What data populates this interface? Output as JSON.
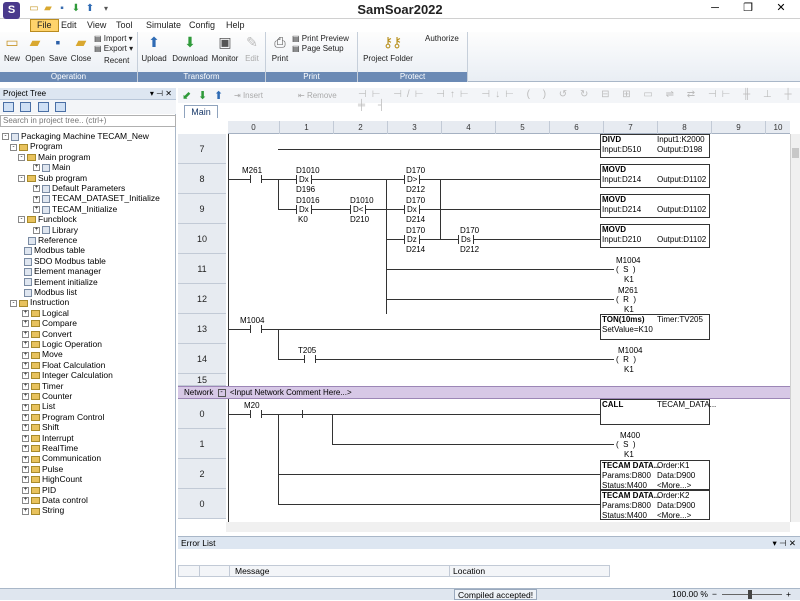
{
  "app": {
    "title": "SamSoar2022",
    "logo": "S"
  },
  "menus": [
    "File",
    "Edit",
    "View",
    "Tool",
    "Simulate",
    "Config",
    "Help"
  ],
  "ribbon": {
    "operation": {
      "label": "Operation",
      "new": "New",
      "open": "Open",
      "save": "Save",
      "close": "Close",
      "import": "Import",
      "export": "Export",
      "recent": "Recent"
    },
    "transform": {
      "label": "Transform",
      "upload": "Upload",
      "download": "Download",
      "monitor": "Monitor",
      "edit": "Edit"
    },
    "print": {
      "label": "Print",
      "print": "Print",
      "preview": "Print Preview",
      "setup": "Page Setup"
    },
    "protect": {
      "label": "Protect",
      "project_folder": "Project Folder",
      "authorize": "Authorize"
    }
  },
  "project_tree": {
    "title": "Project Tree",
    "search_placeholder": "Search in project tree.. (ctrl+)",
    "nodes": [
      "Packaging Machine TECAM_New",
      "Program",
      "Main program",
      "Main",
      "Sub program",
      "Default Parameters",
      "TECAM_DATASET_Initialize",
      "TECAM_Initialize",
      "Funcblock",
      "Library",
      "Reference",
      "Modbus table",
      "SDO Modbus table",
      "Element manager",
      "Element initialize",
      "Modbus list",
      "Instruction",
      "Logical",
      "Compare",
      "Convert",
      "Logic Operation",
      "Move",
      "Float Calculation",
      "Integer Calculation",
      "Timer",
      "Counter",
      "List",
      "Program Control",
      "Shift",
      "Interrupt",
      "RealTime",
      "Communication",
      "Pulse",
      "HighCount",
      "PID",
      "Data control",
      "String"
    ]
  },
  "editor": {
    "tab": "Main",
    "insert": "Insert",
    "remove": "Remove",
    "columns": [
      "0",
      "1",
      "2",
      "3",
      "4",
      "5",
      "6",
      "7",
      "8",
      "9",
      "10"
    ],
    "rows1": [
      "7",
      "8",
      "9",
      "10",
      "11",
      "12",
      "13",
      "14",
      "15"
    ],
    "rows2": [
      "0",
      "1",
      "2",
      "0"
    ],
    "network_label": "Network",
    "network_comment": "<Input Network Comment Here...>",
    "net1": {
      "divd": {
        "name": "DIVD",
        "input1": "Input1:K2000",
        "input": "Input:D510",
        "output": "Output:D198"
      },
      "movd1": {
        "name": "MOVD",
        "input": "Input:D214",
        "output": "Output:D1102"
      },
      "movd2": {
        "name": "MOVD",
        "input": "Input:D214",
        "output": "Output:D1102"
      },
      "movd3": {
        "name": "MOVD",
        "input": "Input:D210",
        "output": "Output:D1102"
      },
      "m261": "M261",
      "d1010a": "D1010",
      "dx_a": "Dx",
      "d196": "D196",
      "d170a": "D170",
      "dgt": "D>",
      "d212a": "D212",
      "d1016": "D1016",
      "dx_b": "Dx",
      "k0": "K0",
      "d1010b": "D1010",
      "dlt": "D<",
      "d210": "D210",
      "d170b": "D170",
      "dx_c": "Dx",
      "d214a": "D214",
      "d170c": "D170",
      "dz": "Dz",
      "d214b": "D214",
      "d170d": "D170",
      "ds": "Ds",
      "d212b": "D212",
      "coil_s": {
        "dev": "M1004",
        "op": "S",
        "k": "K1"
      },
      "coil_r": {
        "dev": "M261",
        "op": "R",
        "k": "K1"
      },
      "m1004": "M1004",
      "ton": {
        "name": "TON(10ms)",
        "timer": "Timer:TV205",
        "setvalue": "SetValue=K10"
      },
      "t205": "T205",
      "coil_r2": {
        "dev": "M1004",
        "op": "R",
        "k": "K1"
      }
    },
    "net2": {
      "m20": "M20",
      "call": {
        "name": "CALL",
        "target": "TECAM_DATA..."
      },
      "coil_s": {
        "dev": "M400",
        "op": "S",
        "k": "K1"
      },
      "fb1": {
        "name": "TECAM DATA...",
        "order": "Order:K1",
        "params": "Params:D800",
        "data": "Data:D900",
        "status": "Status:M400",
        "more": "<More...>"
      },
      "fb2": {
        "name": "TECAM DATA...",
        "order": "Order:K2",
        "params": "Params:D800",
        "data": "Data:D900",
        "status": "Status:M400",
        "more": "<More...>"
      }
    }
  },
  "error_list": {
    "title": "Error List",
    "message": "Message",
    "location": "Location"
  },
  "status": {
    "text": "Compiled accepted!",
    "zoom": "100.00 %"
  }
}
